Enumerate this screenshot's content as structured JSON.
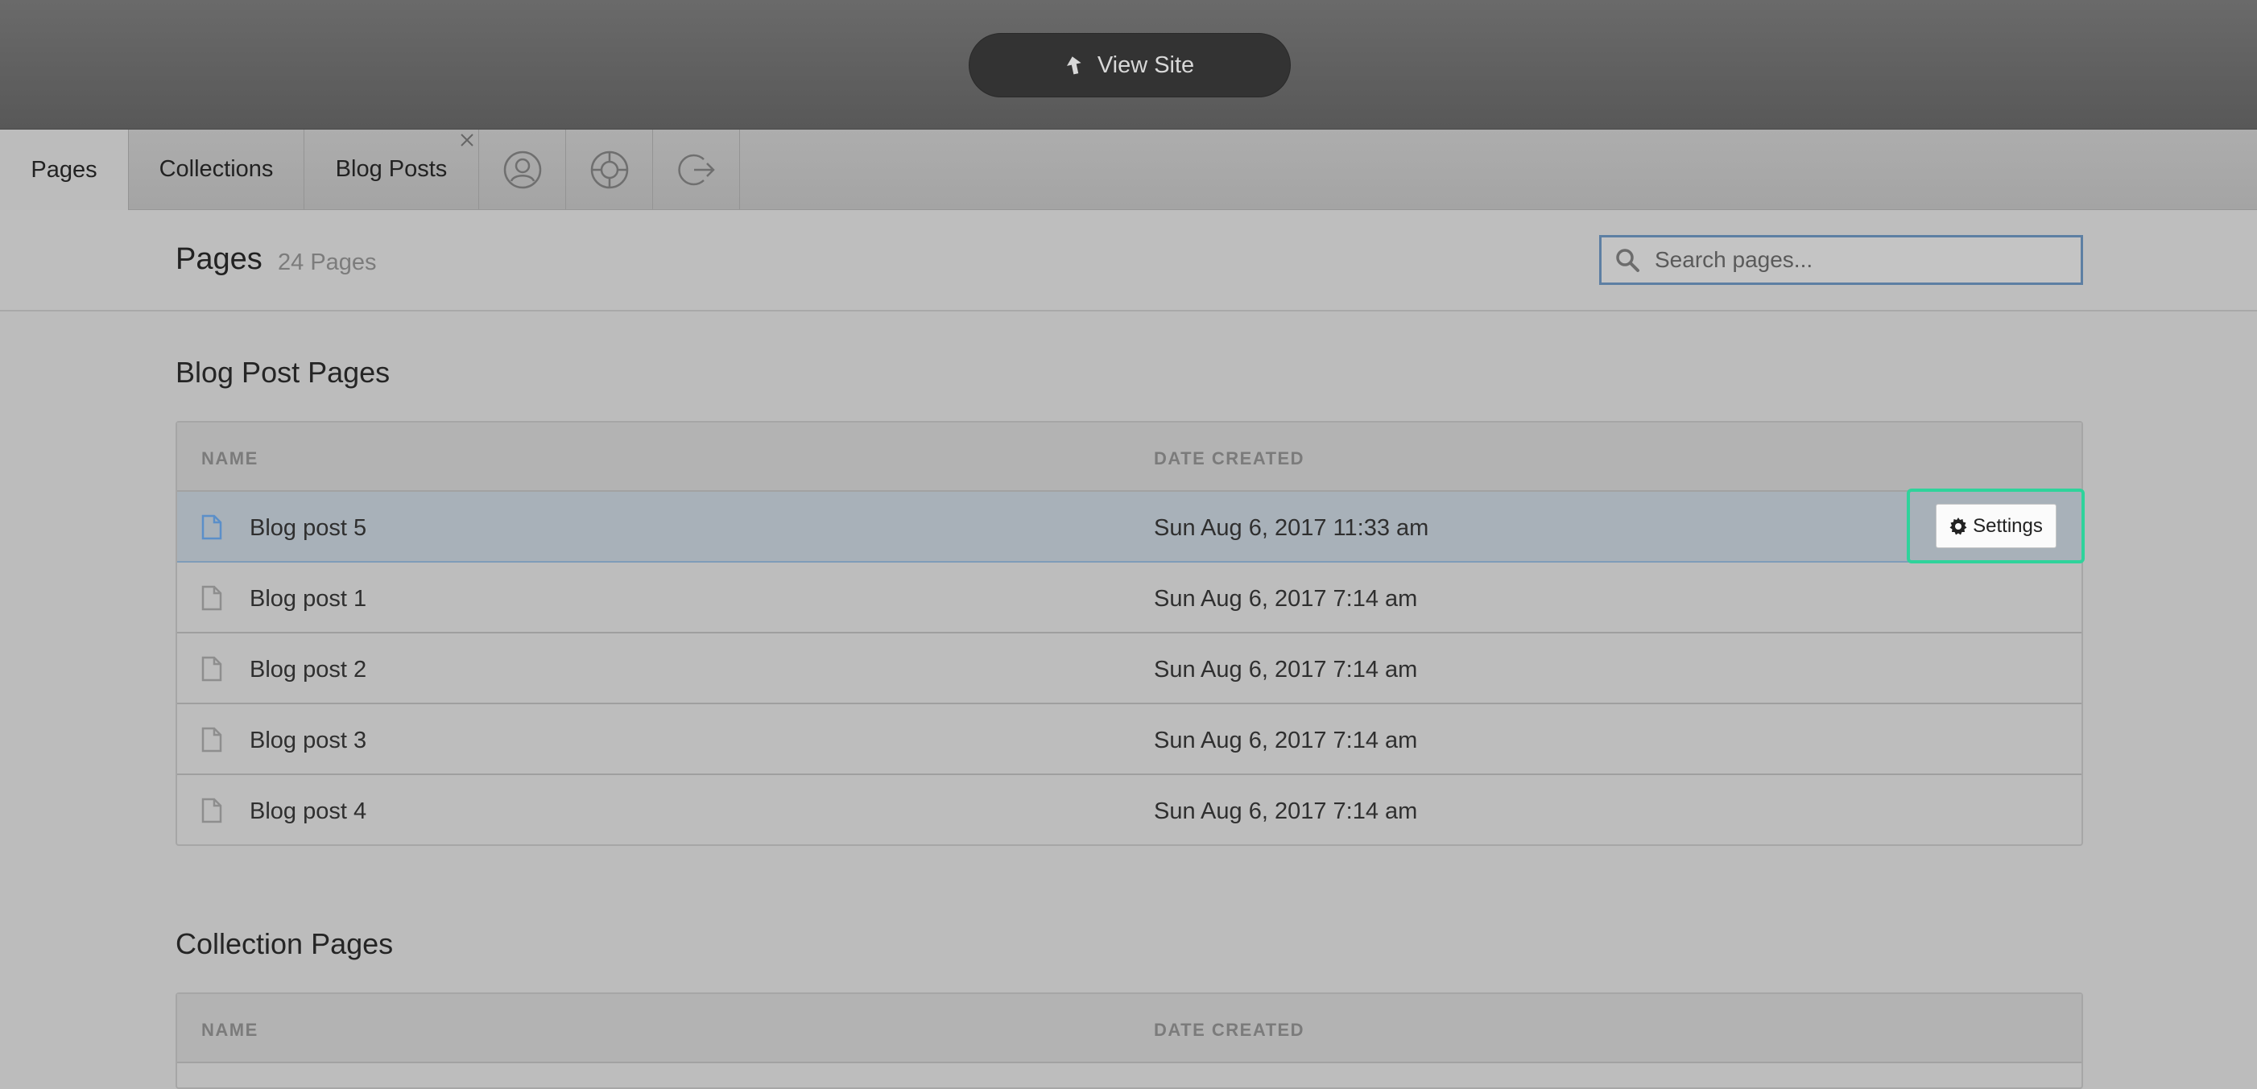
{
  "topbar": {
    "view_site_label": "View Site"
  },
  "tabs": [
    {
      "label": "Pages",
      "active": true
    },
    {
      "label": "Collections",
      "active": false
    },
    {
      "label": "Blog Posts",
      "active": false
    }
  ],
  "icon_tabs": [
    "user-icon",
    "help-lifebuoy-icon",
    "logout-icon"
  ],
  "header": {
    "title": "Pages",
    "count": "24 Pages",
    "search_placeholder": "Search pages..."
  },
  "blog_section": {
    "title": "Blog Post Pages",
    "columns": [
      "NAME",
      "DATE CREATED"
    ],
    "rows": [
      {
        "name": "Blog post 5",
        "date": "Sun Aug 6, 2017 11:33 am"
      },
      {
        "name": "Blog post 1",
        "date": "Sun Aug 6, 2017 7:14 am"
      },
      {
        "name": "Blog post 2",
        "date": "Sun Aug 6, 2017 7:14 am"
      },
      {
        "name": "Blog post 3",
        "date": "Sun Aug 6, 2017 7:14 am"
      },
      {
        "name": "Blog post 4",
        "date": "Sun Aug 6, 2017 7:14 am"
      }
    ],
    "settings_label": "Settings"
  },
  "collection_section": {
    "title": "Collection Pages",
    "columns": [
      "NAME",
      "DATE CREATED"
    ]
  },
  "colors": {
    "highlight": "#2fd39b",
    "search_border": "#5d7fa3",
    "hover_row": "#a8b1b9",
    "active_doc_icon": "#5b8fc9"
  }
}
